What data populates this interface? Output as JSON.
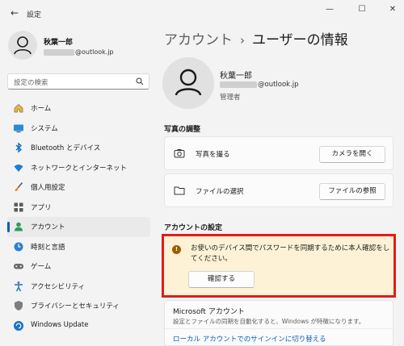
{
  "window": {
    "title": "設定",
    "minimize_glyph": "—",
    "maximize_glyph": "☐",
    "close_glyph": "✕",
    "back_glyph": "←"
  },
  "profile": {
    "name": "秋葉一郎",
    "email_suffix": "@outlook.jp"
  },
  "search": {
    "placeholder": "設定の検索"
  },
  "nav": {
    "items": [
      {
        "label": "ホーム",
        "icon": "home-icon"
      },
      {
        "label": "システム",
        "icon": "system-icon"
      },
      {
        "label": "Bluetooth とデバイス",
        "icon": "bluetooth-icon"
      },
      {
        "label": "ネットワークとインターネット",
        "icon": "wifi-icon"
      },
      {
        "label": "個人用設定",
        "icon": "brush-icon"
      },
      {
        "label": "アプリ",
        "icon": "apps-icon"
      },
      {
        "label": "アカウント",
        "icon": "account-icon",
        "active": true
      },
      {
        "label": "時刻と言語",
        "icon": "time-language-icon"
      },
      {
        "label": "ゲーム",
        "icon": "gaming-icon"
      },
      {
        "label": "アクセシビリティ",
        "icon": "accessibility-icon"
      },
      {
        "label": "プライバシーとセキュリティ",
        "icon": "shield-icon"
      },
      {
        "label": "Windows Update",
        "icon": "update-icon"
      }
    ]
  },
  "breadcrumb": {
    "parent": "アカウント",
    "separator": "›",
    "current": "ユーザーの情報"
  },
  "user": {
    "name": "秋葉一郎",
    "email_suffix": "@outlook.jp",
    "role": "管理者"
  },
  "photo_section": {
    "heading": "写真の調整",
    "take_photo": {
      "label": "写真を撮る",
      "button": "カメラを開く",
      "icon": "camera-icon"
    },
    "choose_file": {
      "label": "ファイルの選択",
      "button": "ファイルの参照",
      "icon": "folder-icon"
    }
  },
  "account_section": {
    "heading": "アカウントの設定",
    "warning_text": "お使いのデバイス間でパスワードを同期するために本人確認をしてください。",
    "warning_icon": "!",
    "verify_button": "確認する",
    "ms_account_title": "Microsoft アカウント",
    "ms_account_desc": "設定とファイルの同期を自動化すると、Windows が特徴になります。",
    "local_link": "ローカル アカウントでのサインインに切り替える"
  },
  "colors": {
    "accent": "#005fb8",
    "warning_bg": "#fdf2d5",
    "warning_icon": "#9d5d00",
    "highlight_border": "#e31b1b"
  }
}
